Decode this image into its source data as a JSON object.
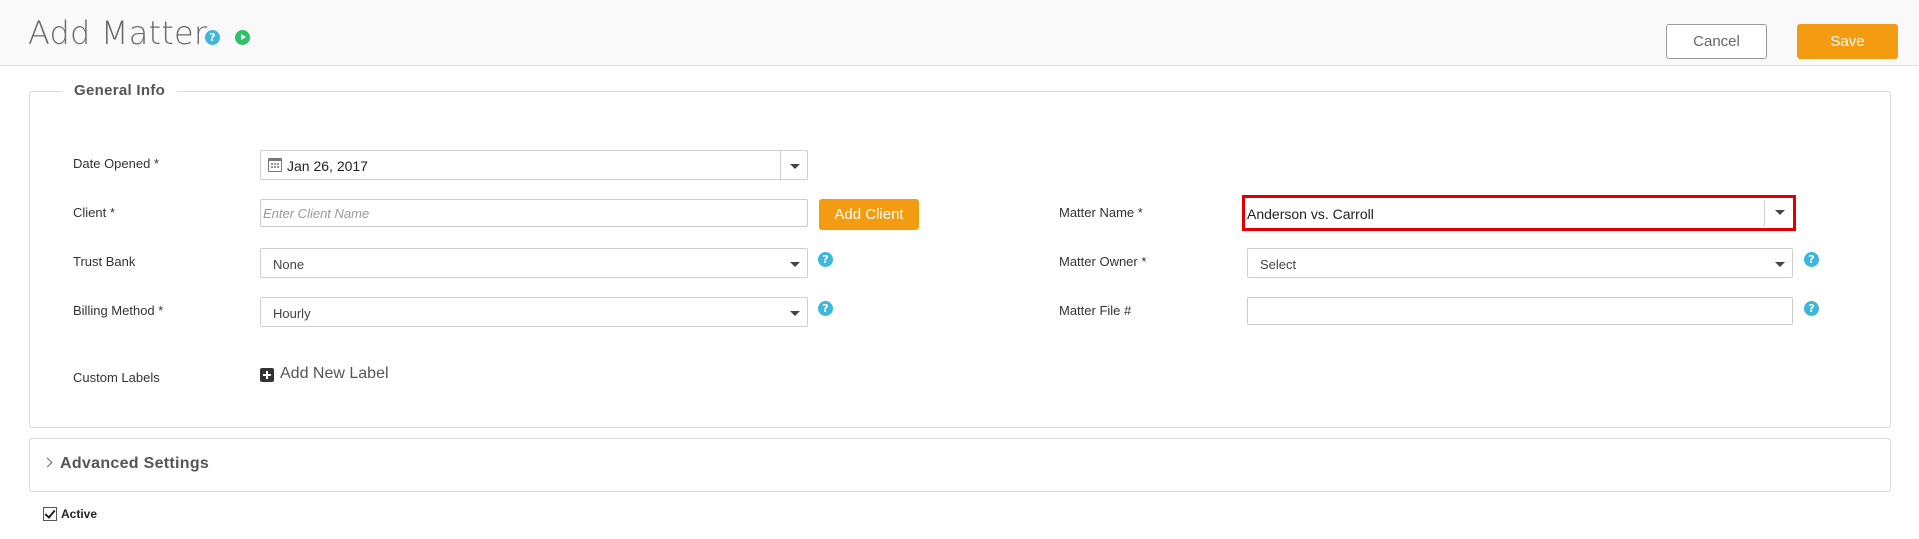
{
  "header": {
    "title": "Add Matter",
    "help_glyph": "?",
    "cancel_label": "Cancel",
    "save_label": "Save"
  },
  "general_info": {
    "legend": "General Info",
    "date_opened": {
      "label": "Date Opened *",
      "value": "Jan 26, 2017"
    },
    "client": {
      "label": "Client *",
      "placeholder": "Enter Client Name",
      "add_button": "Add Client"
    },
    "trust_bank": {
      "label": "Trust Bank",
      "value": "None"
    },
    "billing_method": {
      "label": "Billing Method *",
      "value": "Hourly"
    },
    "custom_labels": {
      "label": "Custom Labels",
      "add_link": "Add New Label"
    },
    "matter_name": {
      "label": "Matter Name *",
      "value": "Anderson vs. Carroll"
    },
    "matter_owner": {
      "label": "Matter Owner *",
      "value": "Select"
    },
    "matter_file": {
      "label": "Matter File #",
      "value": ""
    }
  },
  "advanced": {
    "title": "Advanced Settings"
  },
  "active": {
    "label": "Active",
    "checked": true
  },
  "colors": {
    "accent": "#f39c12",
    "help": "#3fb6dc",
    "play": "#2ec06b",
    "highlight": "#e00000"
  },
  "icons": [
    "help-icon",
    "play-icon",
    "calendar-icon",
    "chevron-down-icon",
    "plus-square-icon",
    "chevron-right-icon",
    "checkbox-check-icon"
  ]
}
